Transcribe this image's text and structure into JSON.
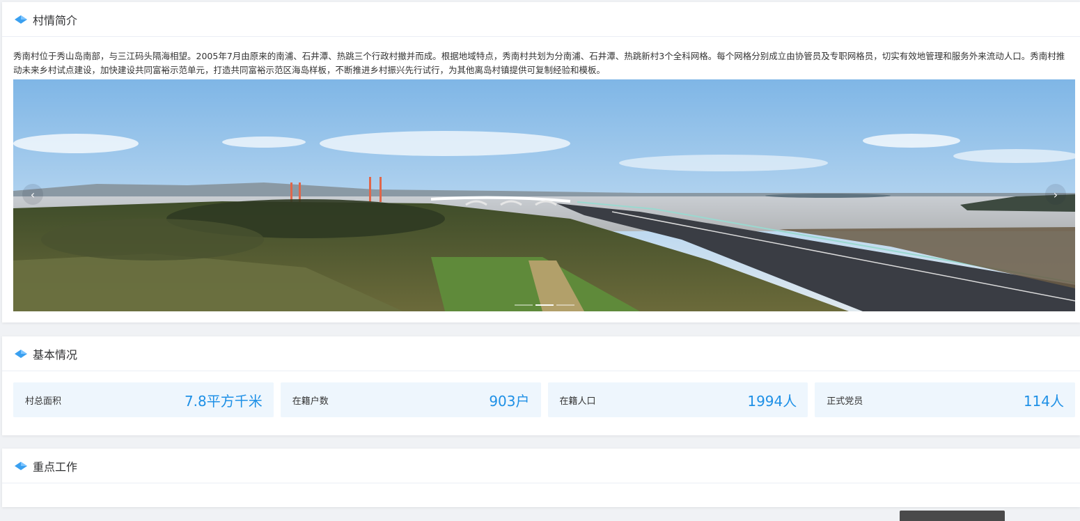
{
  "intro": {
    "title": "村情简介",
    "description": "秀南村位于秀山岛南部，与三江码头隔海相望。2005年7月由原来的南浦、石井潭、热跳三个行政村撤并而成。根据地域特点，秀南村共划为分南浦、石井潭、热跳新村3个全科网格。每个网格分别成立由协管员及专职网格员，切实有效地管理和服务外来流动人口。秀南村推动未来乡村试点建设，加快建设共同富裕示范单元，打造共同富裕示范区海岛样板，不断推进乡村振兴先行试行，为其他离岛村镇提供可复制经验和模板。",
    "carousel": {
      "prev_icon": "‹",
      "next_icon": "›",
      "slide_count": 3,
      "active_slide": 2
    }
  },
  "basic": {
    "title": "基本情况",
    "stats": [
      {
        "label": "村总面积",
        "value": "7.8平方千米"
      },
      {
        "label": "在籍户数",
        "value": "903户"
      },
      {
        "label": "在籍人口",
        "value": "1994人"
      },
      {
        "label": "正式党员",
        "value": "114人"
      }
    ]
  },
  "key_work": {
    "title": "重点工作"
  },
  "colors": {
    "accent": "#1e90e6",
    "stat_bg": "#eef6fd",
    "page_bg": "#f0f2f5"
  },
  "icons": {
    "section_icon": "diamond-icon"
  }
}
